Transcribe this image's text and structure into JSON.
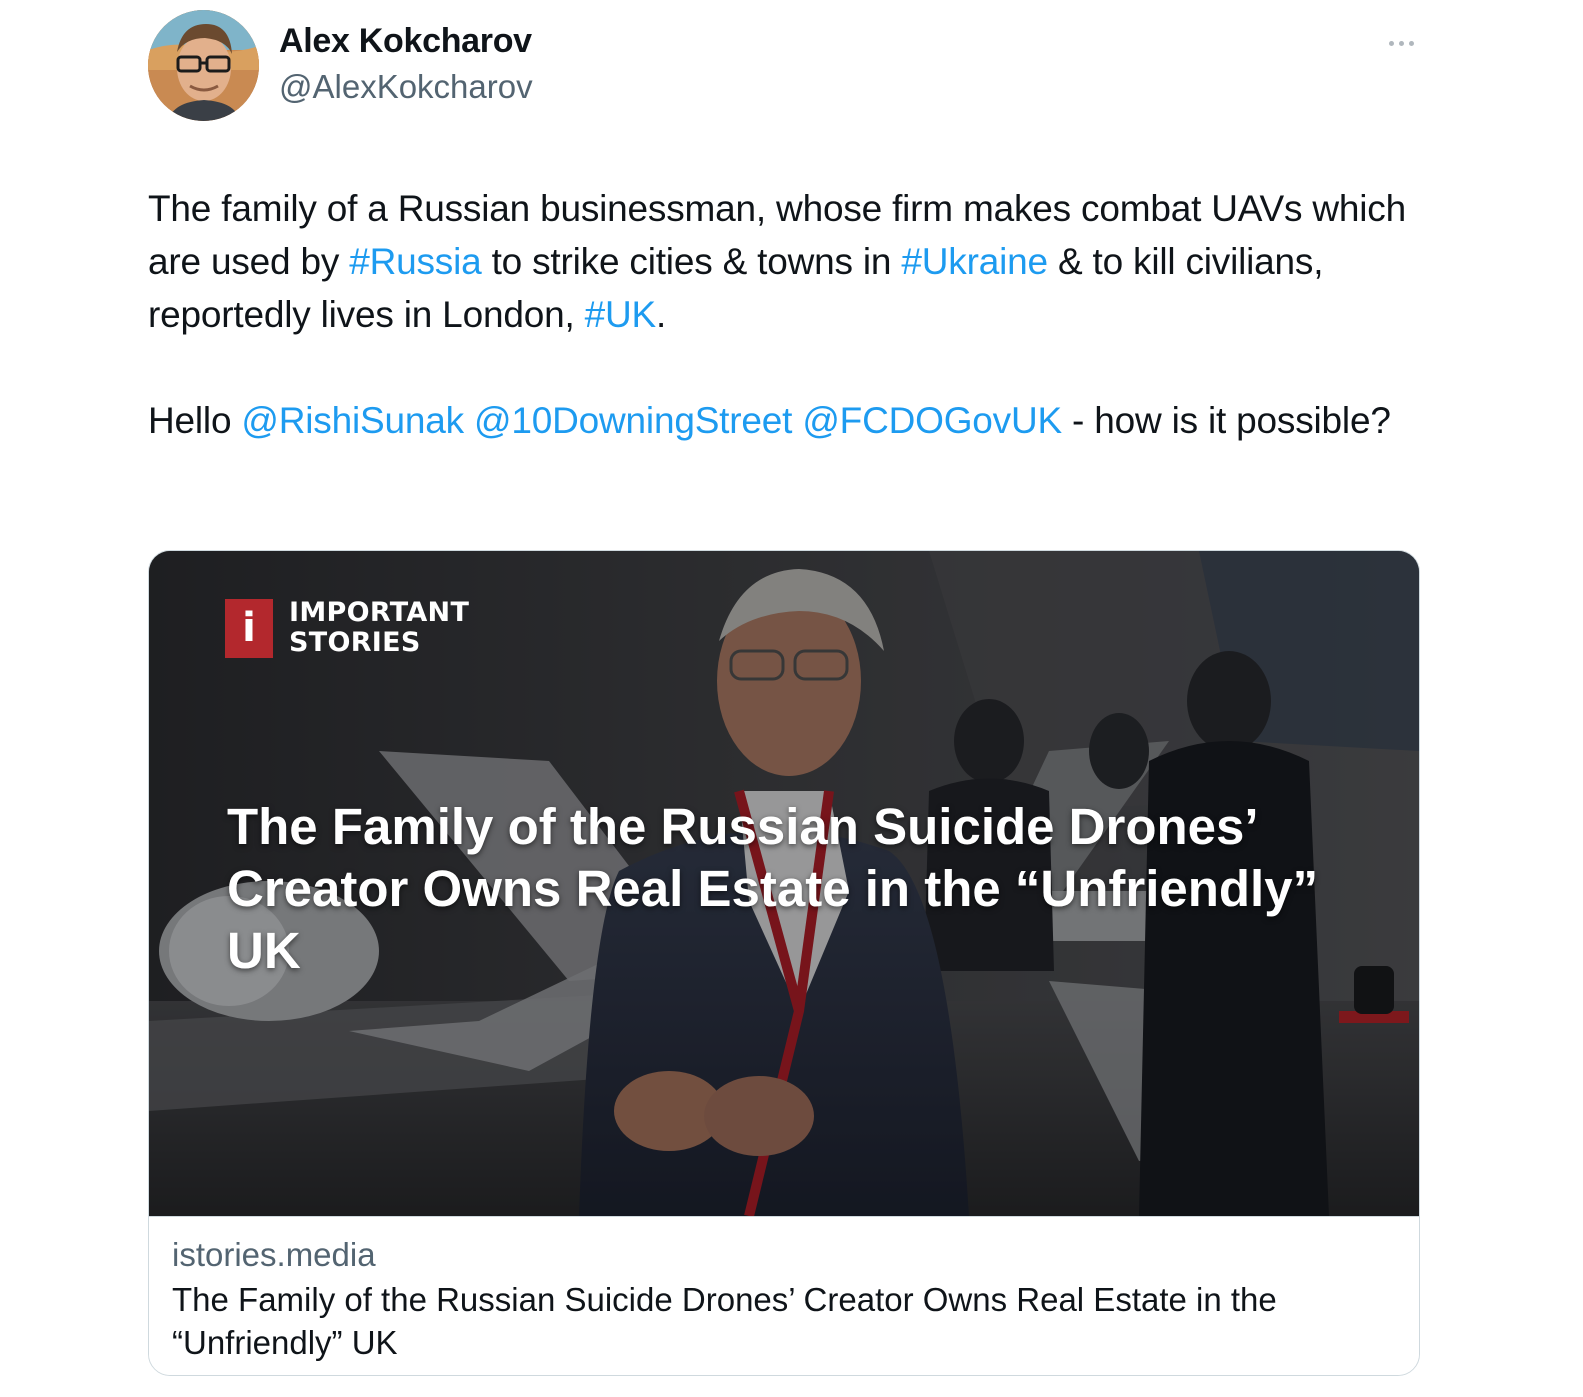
{
  "author": {
    "display_name": "Alex Kokcharov",
    "handle": "@AlexKokcharov",
    "avatar_alt": "avatar"
  },
  "menu": {
    "more_icon": "more-horizontal-icon"
  },
  "tweet": {
    "p1_a": "The family of a Russian businessman, whose firm makes combat UAVs which are used by ",
    "p1_tag1": "#Russia",
    "p1_b": " to strike cities & towns in ",
    "p1_tag2": "#Ukraine",
    "p1_c": " & to kill civilians, reportedly lives in London, ",
    "p1_tag3": "#UK",
    "p1_d": ".",
    "p2_a": "Hello ",
    "p2_mention1": "@RishiSunak",
    "p2_space1": " ",
    "p2_mention2": "@10DowningStreet",
    "p2_space2": " ",
    "p2_mention3": "@FCDOGovUK",
    "p2_b": " - how is it possible?"
  },
  "card": {
    "logo_letter": "i",
    "logo_line1": "IMPORTANT",
    "logo_line2": "STORIES",
    "headline": "The Family of the Russian Suicide Drones’ Creator Owns Real Estate in the “Unfriendly” UK",
    "domain": "istories.media",
    "title": "The Family of the Russian Suicide Drones’ Creator Owns Real Estate in the “Unfriendly” UK"
  },
  "colors": {
    "link": "#1d9bf0",
    "text": "#0f1419",
    "secondary": "#536471",
    "logo_red": "#b3282d"
  }
}
